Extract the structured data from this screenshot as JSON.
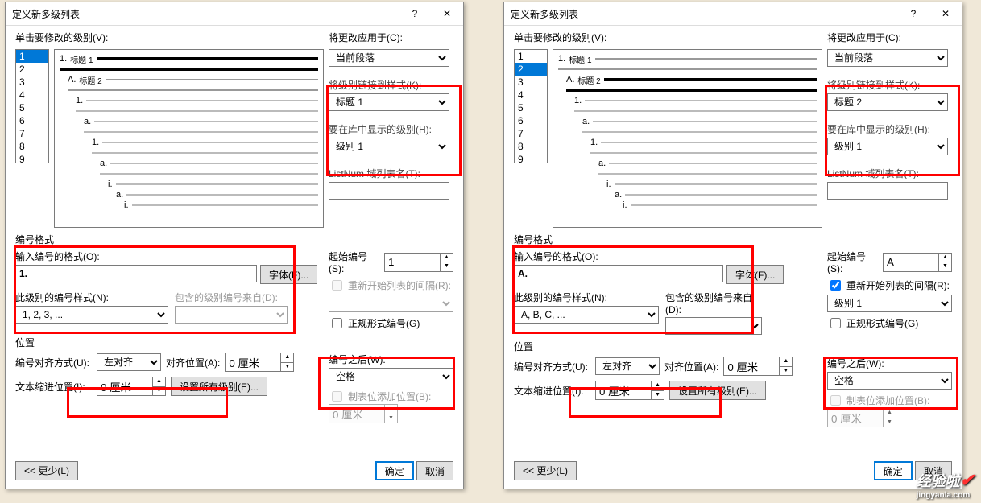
{
  "title": "定义新多级列表",
  "labels": {
    "click_level": "单击要修改的级别(V):",
    "apply_to": "将更改应用于(C):",
    "link_style": "将级别链接到样式(K):",
    "show_level": "要在库中显示的级别(H):",
    "listnum": "ListNum 域列表名(T):",
    "num_format_group": "编号格式",
    "enter_format": "输入编号的格式(O):",
    "font_btn": "字体(F)...",
    "this_level_style": "此级别的编号样式(N):",
    "include_from": "包含的级别编号来自(D):",
    "start_at": "起始编号(S):",
    "restart_after": "重新开始列表的间隔(R):",
    "formal": "正规形式编号(G)",
    "position_group": "位置",
    "align": "编号对齐方式(U):",
    "align_pos": "对齐位置(A):",
    "text_indent": "文本缩进位置(I):",
    "set_all": "设置所有级别(E)...",
    "after_num": "编号之后(W):",
    "tab_pos": "制表位添加位置(B):",
    "less": "<< 更少(L)",
    "ok": "确定",
    "cancel": "取消"
  },
  "left": {
    "selected_level": "1",
    "apply_to_val": "当前段落",
    "link_style_val": "标题 1",
    "show_level_val": "级别 1",
    "format_val": "1.",
    "style_val": "1, 2, 3, ...",
    "start_val": "1",
    "restart_level": "",
    "restart_checked": false,
    "align_val": "左对齐",
    "align_pos_val": "0 厘米",
    "indent_val": "0 厘米",
    "after_val": "空格",
    "tab_val": "0 厘米",
    "formal_checked": false
  },
  "right": {
    "selected_level": "2",
    "apply_to_val": "当前段落",
    "link_style_val": "标题 2",
    "show_level_val": "级别 1",
    "format_val": "A.",
    "style_val": "A, B, C, ...",
    "start_val": "A",
    "restart_level": "级别 1",
    "restart_checked": true,
    "align_val": "左对齐",
    "align_pos_val": "0 厘米",
    "indent_val": "0 厘米",
    "after_val": "空格",
    "tab_val": "0 厘米",
    "formal_checked": false
  },
  "levels": [
    "1",
    "2",
    "3",
    "4",
    "5",
    "6",
    "7",
    "8",
    "9"
  ],
  "preview_rows": [
    {
      "num": "1.",
      "txt": "标题 1",
      "bold": true
    },
    {
      "num": "",
      "txt": "",
      "bold": true,
      "thick": true
    },
    {
      "num": "A.",
      "txt": "标题 2",
      "bold": false
    },
    {
      "num": "1.",
      "txt": ""
    },
    {
      "num": "a.",
      "txt": ""
    },
    {
      "num": "1.",
      "txt": ""
    },
    {
      "num": "a.",
      "txt": ""
    },
    {
      "num": "i.",
      "txt": ""
    },
    {
      "num": "a.",
      "txt": ""
    },
    {
      "num": "i.",
      "txt": ""
    }
  ],
  "watermark": {
    "text": "经验啦",
    "check": "✔",
    "sub": "jingyanla.com"
  }
}
